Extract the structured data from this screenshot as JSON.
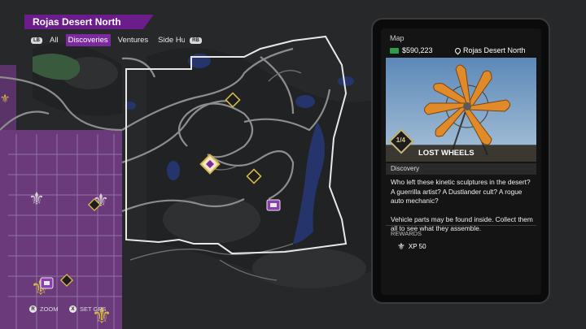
{
  "region": {
    "name": "Rojas Desert North"
  },
  "tabs": {
    "left_button": "LB",
    "right_button": "RB",
    "items": [
      {
        "label": "All"
      },
      {
        "label": "Discoveries"
      },
      {
        "label": "Ventures"
      },
      {
        "label": "Side Hu"
      }
    ],
    "active_index": 1
  },
  "hints": {
    "zoom": {
      "button": "R",
      "label": "ZOOM"
    },
    "gps": {
      "button": "X",
      "label": "SET GPS"
    }
  },
  "panel": {
    "title": "Map",
    "cash": "$590,223",
    "location": "Rojas Desert North",
    "item_title": "LOST WHEELS",
    "badge": "1/4",
    "category": "Discovery",
    "description": [
      "Who left these kinetic sculptures in the desert? A guerrilla artist? A Dustlander cult? A rogue auto mechanic?",
      "Vehicle parts may be found inside. Collect them all to see what they assemble."
    ],
    "rewards_label": "REWARDS",
    "reward": "XP 50"
  },
  "colors": {
    "territory": "#6a3a7a",
    "accent": "#7a2a9e",
    "map_ground": "#2a2c2e",
    "water": "#25356b",
    "roads": "#8d8d8d",
    "icon_gold": "#d6b64a"
  },
  "icons": [
    "fleur-de-lis-icon",
    "discovery-marker-icon",
    "shop-marker-icon",
    "cash-icon",
    "location-pin-icon"
  ]
}
